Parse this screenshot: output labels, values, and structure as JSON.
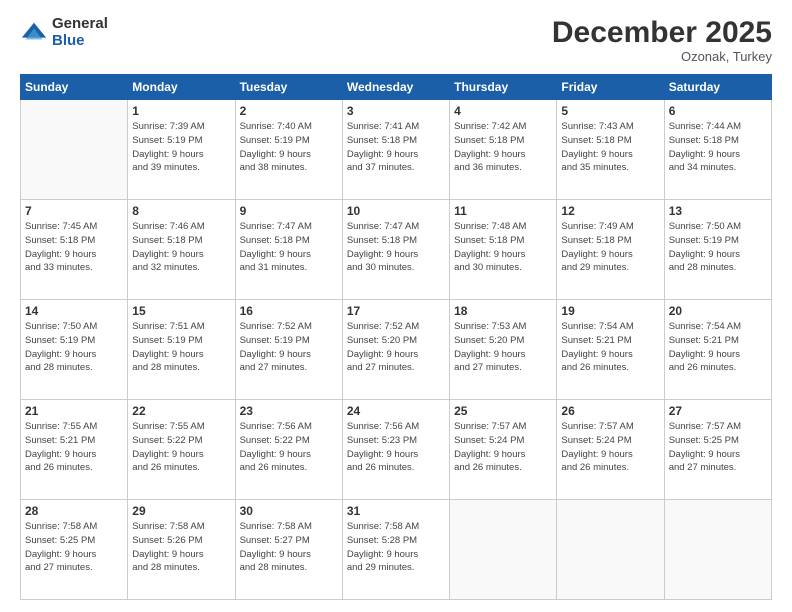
{
  "logo": {
    "general": "General",
    "blue": "Blue"
  },
  "title": "December 2025",
  "subtitle": "Ozonak, Turkey",
  "days_of_week": [
    "Sunday",
    "Monday",
    "Tuesday",
    "Wednesday",
    "Thursday",
    "Friday",
    "Saturday"
  ],
  "weeks": [
    [
      {
        "day": "",
        "sunrise": "",
        "sunset": "",
        "daylight": ""
      },
      {
        "day": "1",
        "sunrise": "Sunrise: 7:39 AM",
        "sunset": "Sunset: 5:19 PM",
        "daylight": "Daylight: 9 hours and 39 minutes."
      },
      {
        "day": "2",
        "sunrise": "Sunrise: 7:40 AM",
        "sunset": "Sunset: 5:19 PM",
        "daylight": "Daylight: 9 hours and 38 minutes."
      },
      {
        "day": "3",
        "sunrise": "Sunrise: 7:41 AM",
        "sunset": "Sunset: 5:18 PM",
        "daylight": "Daylight: 9 hours and 37 minutes."
      },
      {
        "day": "4",
        "sunrise": "Sunrise: 7:42 AM",
        "sunset": "Sunset: 5:18 PM",
        "daylight": "Daylight: 9 hours and 36 minutes."
      },
      {
        "day": "5",
        "sunrise": "Sunrise: 7:43 AM",
        "sunset": "Sunset: 5:18 PM",
        "daylight": "Daylight: 9 hours and 35 minutes."
      },
      {
        "day": "6",
        "sunrise": "Sunrise: 7:44 AM",
        "sunset": "Sunset: 5:18 PM",
        "daylight": "Daylight: 9 hours and 34 minutes."
      }
    ],
    [
      {
        "day": "7",
        "sunrise": "Sunrise: 7:45 AM",
        "sunset": "Sunset: 5:18 PM",
        "daylight": "Daylight: 9 hours and 33 minutes."
      },
      {
        "day": "8",
        "sunrise": "Sunrise: 7:46 AM",
        "sunset": "Sunset: 5:18 PM",
        "daylight": "Daylight: 9 hours and 32 minutes."
      },
      {
        "day": "9",
        "sunrise": "Sunrise: 7:47 AM",
        "sunset": "Sunset: 5:18 PM",
        "daylight": "Daylight: 9 hours and 31 minutes."
      },
      {
        "day": "10",
        "sunrise": "Sunrise: 7:47 AM",
        "sunset": "Sunset: 5:18 PM",
        "daylight": "Daylight: 9 hours and 30 minutes."
      },
      {
        "day": "11",
        "sunrise": "Sunrise: 7:48 AM",
        "sunset": "Sunset: 5:18 PM",
        "daylight": "Daylight: 9 hours and 30 minutes."
      },
      {
        "day": "12",
        "sunrise": "Sunrise: 7:49 AM",
        "sunset": "Sunset: 5:18 PM",
        "daylight": "Daylight: 9 hours and 29 minutes."
      },
      {
        "day": "13",
        "sunrise": "Sunrise: 7:50 AM",
        "sunset": "Sunset: 5:19 PM",
        "daylight": "Daylight: 9 hours and 28 minutes."
      }
    ],
    [
      {
        "day": "14",
        "sunrise": "Sunrise: 7:50 AM",
        "sunset": "Sunset: 5:19 PM",
        "daylight": "Daylight: 9 hours and 28 minutes."
      },
      {
        "day": "15",
        "sunrise": "Sunrise: 7:51 AM",
        "sunset": "Sunset: 5:19 PM",
        "daylight": "Daylight: 9 hours and 28 minutes."
      },
      {
        "day": "16",
        "sunrise": "Sunrise: 7:52 AM",
        "sunset": "Sunset: 5:19 PM",
        "daylight": "Daylight: 9 hours and 27 minutes."
      },
      {
        "day": "17",
        "sunrise": "Sunrise: 7:52 AM",
        "sunset": "Sunset: 5:20 PM",
        "daylight": "Daylight: 9 hours and 27 minutes."
      },
      {
        "day": "18",
        "sunrise": "Sunrise: 7:53 AM",
        "sunset": "Sunset: 5:20 PM",
        "daylight": "Daylight: 9 hours and 27 minutes."
      },
      {
        "day": "19",
        "sunrise": "Sunrise: 7:54 AM",
        "sunset": "Sunset: 5:21 PM",
        "daylight": "Daylight: 9 hours and 26 minutes."
      },
      {
        "day": "20",
        "sunrise": "Sunrise: 7:54 AM",
        "sunset": "Sunset: 5:21 PM",
        "daylight": "Daylight: 9 hours and 26 minutes."
      }
    ],
    [
      {
        "day": "21",
        "sunrise": "Sunrise: 7:55 AM",
        "sunset": "Sunset: 5:21 PM",
        "daylight": "Daylight: 9 hours and 26 minutes."
      },
      {
        "day": "22",
        "sunrise": "Sunrise: 7:55 AM",
        "sunset": "Sunset: 5:22 PM",
        "daylight": "Daylight: 9 hours and 26 minutes."
      },
      {
        "day": "23",
        "sunrise": "Sunrise: 7:56 AM",
        "sunset": "Sunset: 5:22 PM",
        "daylight": "Daylight: 9 hours and 26 minutes."
      },
      {
        "day": "24",
        "sunrise": "Sunrise: 7:56 AM",
        "sunset": "Sunset: 5:23 PM",
        "daylight": "Daylight: 9 hours and 26 minutes."
      },
      {
        "day": "25",
        "sunrise": "Sunrise: 7:57 AM",
        "sunset": "Sunset: 5:24 PM",
        "daylight": "Daylight: 9 hours and 26 minutes."
      },
      {
        "day": "26",
        "sunrise": "Sunrise: 7:57 AM",
        "sunset": "Sunset: 5:24 PM",
        "daylight": "Daylight: 9 hours and 26 minutes."
      },
      {
        "day": "27",
        "sunrise": "Sunrise: 7:57 AM",
        "sunset": "Sunset: 5:25 PM",
        "daylight": "Daylight: 9 hours and 27 minutes."
      }
    ],
    [
      {
        "day": "28",
        "sunrise": "Sunrise: 7:58 AM",
        "sunset": "Sunset: 5:25 PM",
        "daylight": "Daylight: 9 hours and 27 minutes."
      },
      {
        "day": "29",
        "sunrise": "Sunrise: 7:58 AM",
        "sunset": "Sunset: 5:26 PM",
        "daylight": "Daylight: 9 hours and 28 minutes."
      },
      {
        "day": "30",
        "sunrise": "Sunrise: 7:58 AM",
        "sunset": "Sunset: 5:27 PM",
        "daylight": "Daylight: 9 hours and 28 minutes."
      },
      {
        "day": "31",
        "sunrise": "Sunrise: 7:58 AM",
        "sunset": "Sunset: 5:28 PM",
        "daylight": "Daylight: 9 hours and 29 minutes."
      },
      {
        "day": "",
        "sunrise": "",
        "sunset": "",
        "daylight": ""
      },
      {
        "day": "",
        "sunrise": "",
        "sunset": "",
        "daylight": ""
      },
      {
        "day": "",
        "sunrise": "",
        "sunset": "",
        "daylight": ""
      }
    ]
  ]
}
